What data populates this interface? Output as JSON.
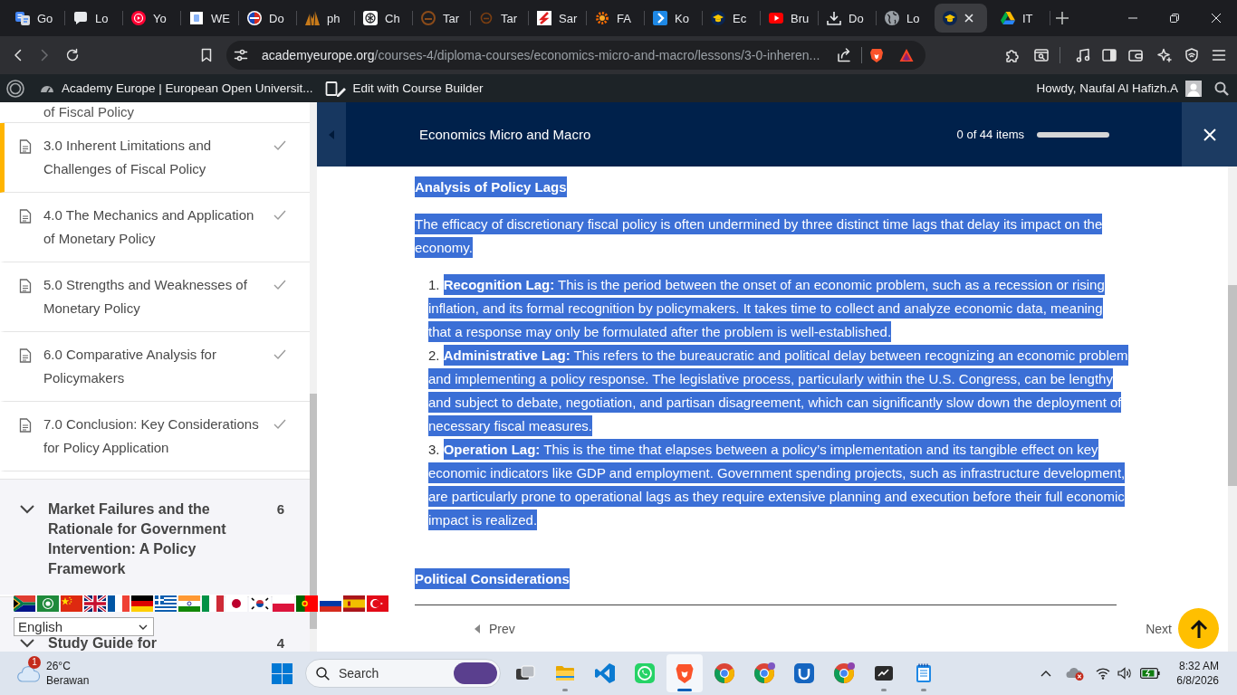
{
  "browser": {
    "tabs": [
      {
        "label": "Go",
        "selected": false
      },
      {
        "label": "Lo",
        "selected": false
      },
      {
        "label": "Yo",
        "selected": false
      },
      {
        "label": "WE",
        "selected": false
      },
      {
        "label": "Do",
        "selected": false
      },
      {
        "label": "ph",
        "selected": false
      },
      {
        "label": "Ch",
        "selected": false
      },
      {
        "label": "Tar",
        "selected": false
      },
      {
        "label": "Tar",
        "selected": false
      },
      {
        "label": "Sar",
        "selected": false
      },
      {
        "label": "FA",
        "selected": false
      },
      {
        "label": "Ko",
        "selected": false
      },
      {
        "label": "Ec",
        "selected": false
      },
      {
        "label": "Bru",
        "selected": false
      },
      {
        "label": "Do",
        "selected": false
      },
      {
        "label": "Lo",
        "selected": false
      },
      {
        "selected": true
      },
      {
        "label": "IT",
        "selected": false
      }
    ],
    "address": {
      "domain": "academyeurope.org",
      "path": "/courses-4/diploma-courses/economics-micro-and-macro/lessons/3-0-inheren..."
    }
  },
  "admin_bar": {
    "site": "Academy Europe | European Open Universit...",
    "edit_link": "Edit with Course Builder",
    "greeting": "Howdy, Naufal Al Hafizh.A"
  },
  "sidebar": {
    "lessons": [
      {
        "kind": "fragment",
        "title": "of Fiscal Policy",
        "selected": false
      },
      {
        "kind": "lesson",
        "title": "3.0 Inherent Limitations and Challenges of Fiscal Policy",
        "selected": true
      },
      {
        "kind": "lesson",
        "title": "4.0 The Mechanics and Application of Monetary Policy",
        "selected": false
      },
      {
        "kind": "lesson",
        "title": "5.0 Strengths and Weaknesses of Monetary Policy",
        "selected": false
      },
      {
        "kind": "lesson",
        "title": "6.0 Comparative Analysis for Policymakers",
        "selected": false
      },
      {
        "kind": "lesson",
        "title": "7.0 Conclusion: Key Considerations for Policy Application",
        "selected": false
      }
    ],
    "sections": [
      {
        "title": "Market Failures and the Rationale for Government Intervention: A Policy Framework",
        "count": "6"
      },
      {
        "title": "Study Guide for",
        "count": "4"
      }
    ]
  },
  "course_header": {
    "title": "Economics Micro and Macro",
    "progress_text": "0 of 44 items",
    "progress": {
      "level": 0
    }
  },
  "lesson": {
    "highlighted": true,
    "blocks": [
      {
        "kind": "heading",
        "text": "Analysis of Policy Lags"
      },
      {
        "kind": "paragraph",
        "text": "The efficacy of discretionary fiscal policy is often undermined by three distinct time lags that delay its impact on the economy."
      },
      {
        "kind": "list",
        "items": [
          {
            "number": "1.",
            "text": "**Recognition Lag:** This is the period between the onset of an economic problem, such as a recession or rising inflation, and its formal recognition by policymakers. It takes time to collect and analyze economic data, meaning that a response may only be formulated after the problem is well-established."
          },
          {
            "number": "2.",
            "text": "**Administrative Lag:** This refers to the bureaucratic and political delay between recognizing an economic problem and implementing a policy response. The legislative process, particularly within the U.S. Congress, can be lengthy and subject to debate, negotiation, and partisan disagreement, which can significantly slow down the deployment of necessary fiscal measures."
          },
          {
            "number": "3.",
            "text": "**Operation Lag:** This is the time that elapses between a policy’s implementation and its tangible effect on key economic indicators like GDP and employment. Government spending projects, such as infrastructure development, are particularly prone to operational lags as they require extensive planning and execution before their full economic impact is realized."
          }
        ]
      },
      {
        "kind": "heading",
        "text": "Political Considerations"
      }
    ]
  },
  "pagination": {
    "prev": "Prev",
    "next": "Next"
  },
  "language_select": {
    "value": "English"
  },
  "taskbar": {
    "weather": {
      "badge": "1",
      "temperature": "26°C",
      "condition": "Berawan"
    },
    "search": {
      "placeholder": "Search"
    },
    "apps": [
      {
        "selected": false,
        "running": false
      },
      {
        "selected": false,
        "running": true
      },
      {
        "selected": false,
        "running": false
      },
      {
        "selected": false,
        "running": false
      },
      {
        "selected": true,
        "running": true
      },
      {
        "selected": false,
        "running": false
      },
      {
        "selected": false,
        "running": false
      },
      {
        "selected": false,
        "running": false
      },
      {
        "selected": false,
        "running": false
      },
      {
        "selected": false,
        "running": true
      },
      {
        "selected": false,
        "running": true
      }
    ],
    "clock": {
      "time": "8:32 AM",
      "date": "6/8/2026"
    }
  }
}
